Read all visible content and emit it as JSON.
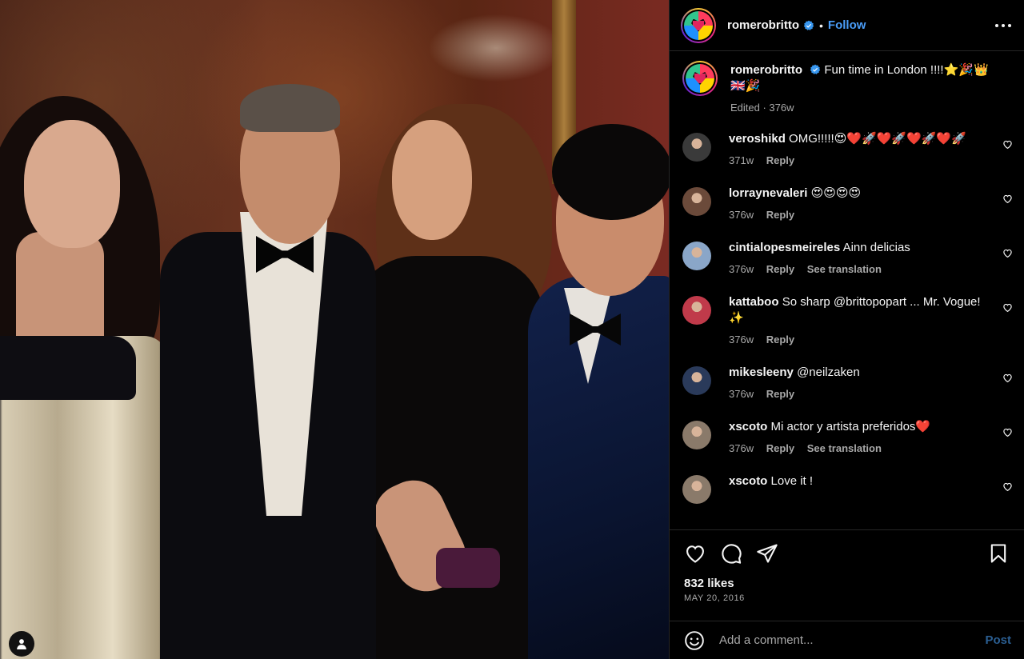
{
  "post": {
    "username": "romerobritto",
    "follow_label": "Follow",
    "dot": "•",
    "caption": {
      "username": "romerobritto",
      "text": "Fun time in London !!!!⭐🎉👑🇬🇧🎉",
      "meta": "Edited · 376w"
    },
    "likes": "832 likes",
    "date": "MAY 20, 2016"
  },
  "comments": [
    {
      "user": "veroshikd",
      "text": "OMG!!!!!😍❤️🚀❤️🚀❤️🚀❤️🚀",
      "age": "371w",
      "reply": "Reply",
      "translate": "",
      "avatar_color": "#3a3a3a"
    },
    {
      "user": "lorraynevaleri",
      "text": "😍😍😍😍",
      "age": "376w",
      "reply": "Reply",
      "translate": "",
      "avatar_color": "#6b4a3a"
    },
    {
      "user": "cintialopesmeireles",
      "text": "Ainn delicias",
      "age": "376w",
      "reply": "Reply",
      "translate": "See translation",
      "avatar_color": "#8aa6c8"
    },
    {
      "user": "kattaboo",
      "text": "So sharp @brittopopart ... Mr. Vogue! ✨",
      "age": "376w",
      "reply": "Reply",
      "translate": "",
      "avatar_color": "#c03a4a"
    },
    {
      "user": "mikesleeny",
      "text": "@neilzaken",
      "age": "376w",
      "reply": "Reply",
      "translate": "",
      "avatar_color": "#2a3a5a"
    },
    {
      "user": "xscoto",
      "text": "Mi actor y artista preferidos❤️",
      "age": "376w",
      "reply": "Reply",
      "translate": "See translation",
      "avatar_color": "#8a7a6a"
    },
    {
      "user": "xscoto",
      "text": "Love it !",
      "age": "",
      "reply": "",
      "translate": "",
      "avatar_color": "#8a7a6a"
    }
  ],
  "add_comment": {
    "placeholder": "Add a comment...",
    "post_label": "Post"
  },
  "icons": {
    "avatar": "romerobritto-heart-avatar",
    "verified": "verified-badge-icon",
    "more": "more-options-icon",
    "like": "heart-icon",
    "comment": "comment-icon",
    "share": "share-icon",
    "save": "bookmark-icon",
    "emoji": "emoji-icon",
    "tagged_user": "user-icon"
  },
  "colors": {
    "accent": "#4a9df8",
    "post_disabled": "#2b5f93",
    "muted": "#a8a8a8"
  }
}
